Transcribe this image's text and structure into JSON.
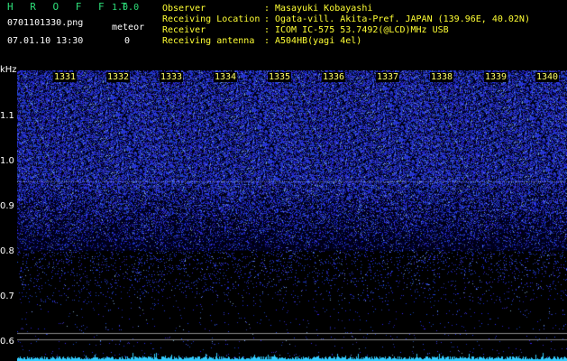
{
  "app": {
    "name": "H R O F F T",
    "version": "1.0.0"
  },
  "file": {
    "name": "0701101330.png",
    "datetime": "07.01.10 13:30"
  },
  "meteor": {
    "label": "meteor",
    "count": "0"
  },
  "meta": [
    {
      "key": "Observer",
      "value": "Masayuki Kobayashi"
    },
    {
      "key": "Receiving Location",
      "value": "Ogata-vill. Akita-Pref. JAPAN (139.96E, 40.02N)"
    },
    {
      "key": "Receiver",
      "value": "ICOM IC-575 53.7492(@LCD)MHz USB"
    },
    {
      "key": "Receiving antenna",
      "value": "A504HB(yagi 4el)"
    }
  ],
  "separator": ":",
  "yaxis": {
    "unit": "kHz",
    "ticks": [
      "1.1",
      "1.0",
      "0.9",
      "0.8",
      "0.7",
      "0.6"
    ]
  },
  "time_marks": [
    "1331",
    "1332",
    "1333",
    "1334",
    "1335",
    "1336",
    "1337",
    "1338",
    "1339",
    "1340"
  ],
  "colors": {
    "header": "#2ee07a",
    "text": "#ffffff",
    "marks": "#ffff66",
    "noise": "#3a4cff",
    "trace": "#33ccff"
  }
}
